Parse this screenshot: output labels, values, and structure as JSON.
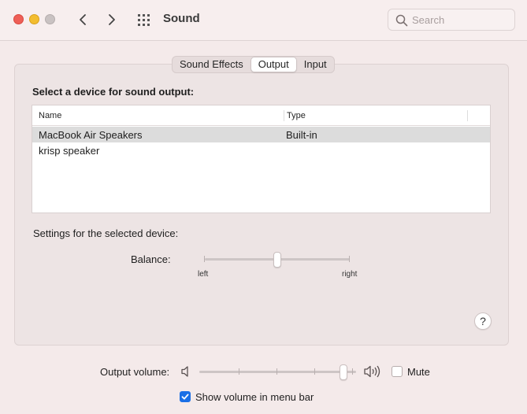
{
  "window": {
    "title": "Sound"
  },
  "search": {
    "placeholder": "Search",
    "value": ""
  },
  "tabs": [
    {
      "label": "Sound Effects",
      "active": false
    },
    {
      "label": "Output",
      "active": true
    },
    {
      "label": "Input",
      "active": false
    }
  ],
  "output": {
    "section_title": "Select a device for sound output:",
    "columns": [
      "Name",
      "Type"
    ],
    "devices": [
      {
        "name": "MacBook Air Speakers",
        "type": "Built-in",
        "selected": true
      },
      {
        "name": "krisp speaker",
        "type": "",
        "selected": false
      }
    ],
    "settings_label": "Settings for the selected device:",
    "balance": {
      "label": "Balance:",
      "left_label": "left",
      "right_label": "right",
      "value": 0.5
    }
  },
  "help_label": "?",
  "volume": {
    "label": "Output volume:",
    "value": 0.92,
    "mute_label": "Mute",
    "muted": false,
    "menu_bar_label": "Show volume in menu bar",
    "show_in_menu_bar": true
  },
  "colors": {
    "accent": "#1a6fe6",
    "selected_row": "#dcdcdc"
  },
  "icons": [
    "close-icon",
    "minimize-icon",
    "zoom-icon",
    "chevron-left-icon",
    "chevron-right-icon",
    "grid-icon",
    "search-icon",
    "speaker-low-icon",
    "speaker-high-icon",
    "checkmark-icon"
  ]
}
